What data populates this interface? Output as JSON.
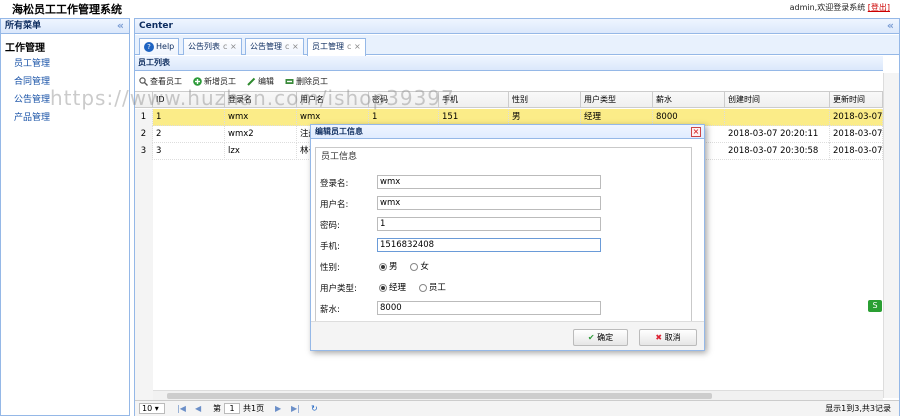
{
  "app": {
    "title": "海松员工工作管理系统",
    "user_text": "admin,欢迎登录系统",
    "logout": "[登出]"
  },
  "west": {
    "title": "所有菜单",
    "collapse": "«",
    "group": "工作管理",
    "items": [
      "员工管理",
      "合同管理",
      "公告管理",
      "产品管理"
    ]
  },
  "center": {
    "title": "Center",
    "collapse": "«"
  },
  "tabs": [
    {
      "label": "Help"
    },
    {
      "label": "公告列表",
      "close": "c ×"
    },
    {
      "label": "公告管理",
      "close": "c ×"
    },
    {
      "label": "员工管理",
      "close": "c ×"
    }
  ],
  "panel": {
    "title": "员工列表"
  },
  "toolbar": {
    "view": "查看员工",
    "add": "新增员工",
    "edit": "编辑",
    "delete": "删除员工"
  },
  "grid": {
    "columns": [
      "ID",
      "登录名",
      "用户名",
      "密码",
      "手机",
      "性别",
      "用户类型",
      "薪水",
      "创建时间",
      "更新时间"
    ],
    "rows": [
      {
        "rn": "1",
        "id": "1",
        "login": "wmx",
        "user": "wmx",
        "pwd": "1",
        "phone": "151",
        "sex": "男",
        "type": "经理",
        "salary": "8000",
        "created": "",
        "updated": "2018-03-07"
      },
      {
        "rn": "2",
        "id": "2",
        "login": "wmx2",
        "user": "注册",
        "pwd": "",
        "phone": "",
        "sex": "",
        "type": "",
        "salary": "",
        "created": "2018-03-07 20:20:11",
        "updated": "2018-03-07"
      },
      {
        "rn": "3",
        "id": "3",
        "login": "lzx",
        "user": "林子",
        "pwd": "",
        "phone": "",
        "sex": "",
        "type": "",
        "salary": "",
        "created": "2018-03-07 20:30:58",
        "updated": "2018-03-07"
      }
    ]
  },
  "pager": {
    "page_size": "10",
    "page_label": "第",
    "page": "1",
    "total_pages": "共1页",
    "summary": "显示1到3,共3记录"
  },
  "watermark": "https://www.huzhan.com/ishop39397",
  "dialog": {
    "title": "编辑员工信息",
    "legend": "员工信息",
    "fields": {
      "login": {
        "label": "登录名:",
        "value": "wmx"
      },
      "user": {
        "label": "用户名:",
        "value": "wmx"
      },
      "pwd": {
        "label": "密码:",
        "value": "1"
      },
      "phone": {
        "label": "手机:",
        "value": "15168324​08"
      },
      "sex": {
        "label": "性别:",
        "opt1": "男",
        "opt2": "女"
      },
      "type": {
        "label": "用户类型:",
        "opt1": "经理",
        "opt2": "员工"
      },
      "salary": {
        "label": "薪水:",
        "value": "8000"
      }
    },
    "ok": "确定",
    "cancel": "取消"
  },
  "side_icon": "S"
}
